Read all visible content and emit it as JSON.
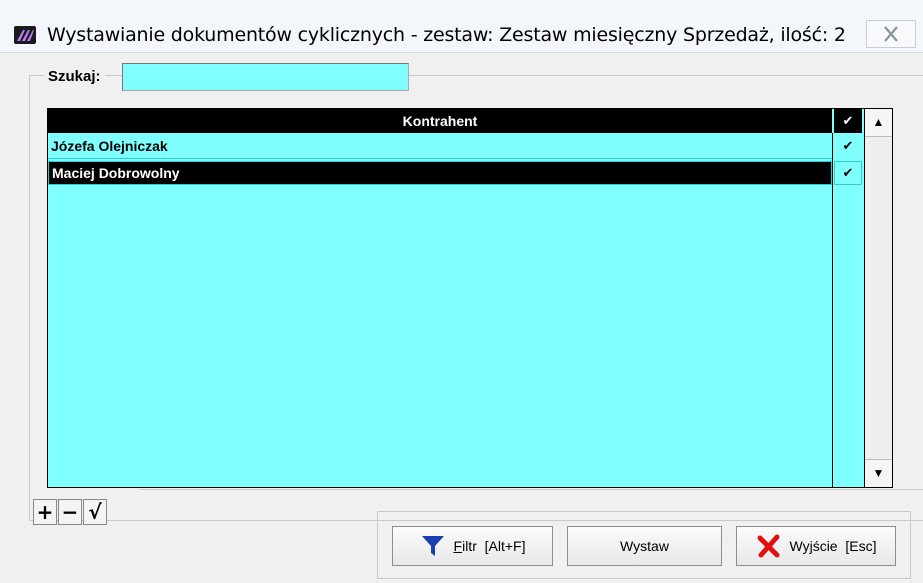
{
  "window": {
    "title": "Wystawianie dokumentów cyklicznych - zestaw: Zestaw miesięczny Sprzedaż, ilość: 2",
    "close_icon": "close-icon",
    "app_icon": "app-logo-icon"
  },
  "search": {
    "label": "Szukaj:",
    "value": "",
    "placeholder": ""
  },
  "grid": {
    "header": "Kontrahent",
    "header_check": "✔",
    "rows": [
      {
        "name": "Józefa Olejniczak",
        "check": "✔",
        "selected": false
      },
      {
        "name": "Maciej Dobrowolny",
        "check": "✔",
        "selected": true
      }
    ],
    "scroll_up": "▲",
    "scroll_down": "▼"
  },
  "nav": {
    "add": "+",
    "remove": "−",
    "confirm": "√"
  },
  "buttons": {
    "filter": {
      "label_underlined": "F",
      "label_rest": "iltr  [Alt+F]",
      "icon": "filter-icon"
    },
    "issue": {
      "label": "Wystaw"
    },
    "exit": {
      "label": "Wyjście  [Esc]",
      "icon": "close-x-icon"
    }
  },
  "colors": {
    "grid_bg": "#80ffff",
    "selected_row_bg": "#000000",
    "header_bg": "#000000",
    "filter_icon": "#1a3fb0",
    "exit_icon": "#e01010"
  }
}
